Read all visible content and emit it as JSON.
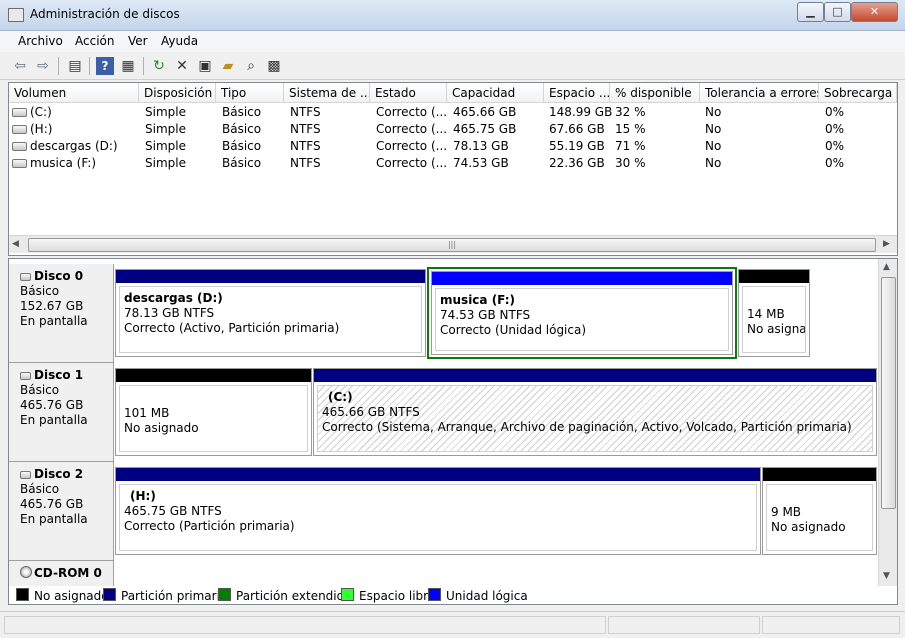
{
  "window": {
    "title": "Administración de discos"
  },
  "menu": [
    "Archivo",
    "Acción",
    "Ver",
    "Ayuda"
  ],
  "toolbar": {
    "icons": [
      "back-icon",
      "forward-icon",
      "panel-icon",
      "help-icon",
      "list-icon",
      "refresh-icon",
      "delete-icon",
      "properties-icon",
      "open-icon",
      "search-icon",
      "view-icon"
    ]
  },
  "volumes": {
    "columns": [
      "Volumen",
      "Disposición",
      "Tipo",
      "Sistema de ...",
      "Estado",
      "Capacidad",
      "Espacio ...",
      "% disponible",
      "Tolerancia a errores",
      "Sobrecarga"
    ],
    "rows": [
      [
        "(C:)",
        "Simple",
        "Básico",
        "NTFS",
        "Correcto (...",
        "465.66 GB",
        "148.99 GB",
        "32 %",
        "No",
        "0%"
      ],
      [
        "(H:)",
        "Simple",
        "Básico",
        "NTFS",
        "Correcto (...",
        "465.75 GB",
        "67.66 GB",
        "15 %",
        "No",
        "0%"
      ],
      [
        "descargas (D:)",
        "Simple",
        "Básico",
        "NTFS",
        "Correcto (...",
        "78.13 GB",
        "55.19 GB",
        "71 %",
        "No",
        "0%"
      ],
      [
        "musica (F:)",
        "Simple",
        "Básico",
        "NTFS",
        "Correcto (...",
        "74.53 GB",
        "22.36 GB",
        "30 %",
        "No",
        "0%"
      ]
    ]
  },
  "disks": [
    {
      "name": "Disco 0",
      "type": "Básico",
      "size": "152.67 GB",
      "status": "En pantalla",
      "partitions": [
        {
          "name": "descargas  (D:)",
          "size": "78.13 GB NTFS",
          "status": "Correcto (Activo, Partición primaria)"
        },
        {
          "name": "musica  (F:)",
          "size": "74.53 GB NTFS",
          "status": "Correcto (Unidad lógica)"
        },
        {
          "name": "",
          "size": "14 MB",
          "status": "No asignado"
        }
      ]
    },
    {
      "name": "Disco 1",
      "type": "Básico",
      "size": "465.76 GB",
      "status": "En pantalla",
      "partitions": [
        {
          "name": "",
          "size": "101 MB",
          "status": "No asignado"
        },
        {
          "name": "(C:)",
          "size": "465.66 GB NTFS",
          "status": "Correcto (Sistema, Arranque, Archivo de paginación, Activo, Volcado, Partición primaria)"
        }
      ]
    },
    {
      "name": "Disco 2",
      "type": "Básico",
      "size": "465.76 GB",
      "status": "En pantalla",
      "partitions": [
        {
          "name": "(H:)",
          "size": "465.75 GB NTFS",
          "status": "Correcto (Partición primaria)"
        },
        {
          "name": "",
          "size": "9 MB",
          "status": "No asignado"
        }
      ]
    },
    {
      "name": "CD-ROM 0"
    }
  ],
  "legend": [
    {
      "label": "No asignado",
      "color": "#000000"
    },
    {
      "label": "Partición primaria",
      "color": "#000080"
    },
    {
      "label": "Partición extendida",
      "color": "#008000"
    },
    {
      "label": "Espacio libre",
      "color": "#33ff33"
    },
    {
      "label": "Unidad lógica",
      "color": "#0000ff"
    }
  ],
  "colors": {
    "unallocated": "#000000",
    "primary": "#000080",
    "logical": "#0000ff",
    "extended": "#0a7a0a"
  }
}
